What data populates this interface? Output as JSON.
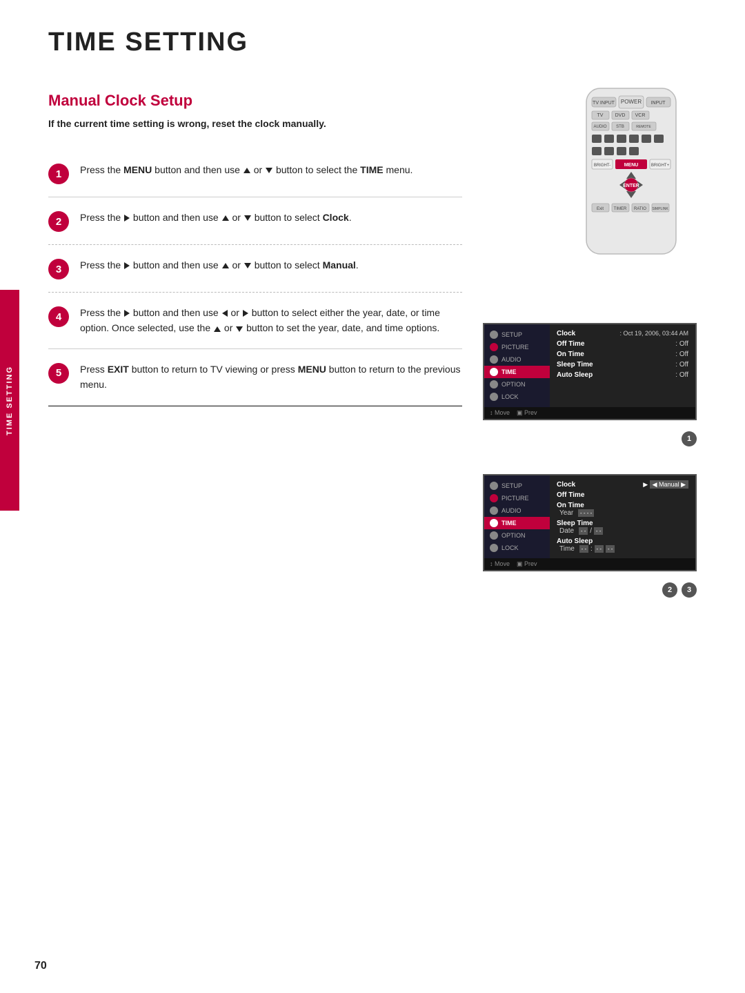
{
  "page": {
    "title": "TIME SETTING",
    "sidebar_label": "TIME SETTING",
    "page_number": "70"
  },
  "section": {
    "title": "Manual Clock Setup",
    "subtitle": "If the current time setting is wrong, reset the clock manually."
  },
  "steps": [
    {
      "number": "1",
      "text_parts": [
        "Press the ",
        "MENU",
        " button and then use ",
        "▲",
        " or ",
        "▼",
        " button to select the ",
        "TIME",
        " menu."
      ]
    },
    {
      "number": "2",
      "text_parts": [
        "Press the ",
        "▶",
        " button and then use ",
        "▲",
        " or ",
        "▼",
        " button to select ",
        "Clock",
        "."
      ]
    },
    {
      "number": "3",
      "text_parts": [
        "Press the ",
        "▶",
        " button and then use ",
        "▲",
        " or ",
        "▼",
        " button to select ",
        "Manual",
        "."
      ]
    },
    {
      "number": "4",
      "text_parts": [
        "Press the ",
        "▶",
        " button and then use ",
        "◀",
        " or ",
        "▶",
        " button to select either the year, date, or time option. Once selected, use the ",
        "▲",
        " or ",
        "▼",
        " button to set the year, date, and time options."
      ]
    },
    {
      "number": "5",
      "text_parts": [
        "Press ",
        "EXIT",
        " button to return to TV viewing or press ",
        "MENU",
        " button to return to the previous menu."
      ]
    }
  ],
  "screen1": {
    "menu_items": [
      "SETUP",
      "PICTURE",
      "AUDIO",
      "TIME",
      "OPTION",
      "LOCK"
    ],
    "active_item": "TIME",
    "rows": [
      {
        "label": "Clock",
        "value": ": Oct 19, 2006, 03:44 AM"
      },
      {
        "label": "Off Time",
        "value": ": Off"
      },
      {
        "label": "On Time",
        "value": ": Off"
      },
      {
        "label": "Sleep Time",
        "value": ": Off"
      },
      {
        "label": "Auto Sleep",
        "value": ": Off"
      }
    ],
    "footer": [
      "↕ Move",
      "ENTER Prev"
    ],
    "badge": "1"
  },
  "screen2": {
    "menu_items": [
      "SETUP",
      "PICTURE",
      "AUDIO",
      "TIME",
      "OPTION",
      "LOCK"
    ],
    "active_item": "TIME",
    "rows": [
      {
        "label": "Clock",
        "arrow": "▶",
        "value": "◀ Manual ▶"
      },
      {
        "label": "Off Time",
        "value": ""
      },
      {
        "label": "On Time",
        "value": "Year  - - - -"
      },
      {
        "label": "Sleep Time",
        "value": "Date  - -  /  - -"
      },
      {
        "label": "Auto Sleep",
        "value": "Time  - - : - -  - -"
      }
    ],
    "footer": [
      "↕ Move",
      "ENTER Prev"
    ],
    "badges": [
      "2",
      "3"
    ]
  }
}
